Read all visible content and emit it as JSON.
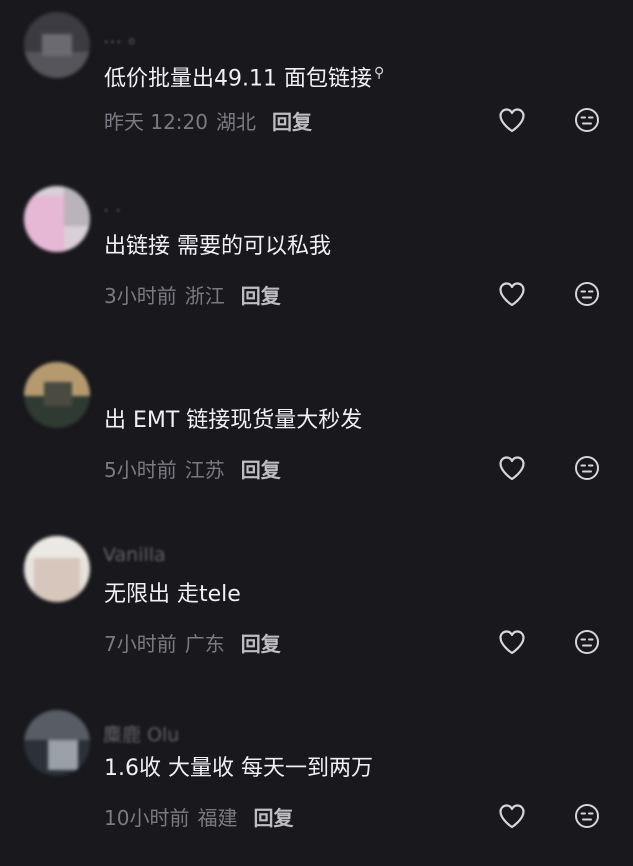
{
  "comments": [
    {
      "username": "… 。",
      "text": "低价批量出49.11 面包链接",
      "time": "昨天 12:20",
      "location": "湖北",
      "reply": "回复",
      "has_search_icon": true
    },
    {
      "username": "· ·",
      "text": "出链接 需要的可以私我",
      "time": "3小时前",
      "location": "浙江",
      "reply": "回复"
    },
    {
      "username": "",
      "text": "出 EMT  链接现货量大秒发",
      "time": "5小时前",
      "location": "江苏",
      "reply": "回复"
    },
    {
      "username": "Vanilla",
      "text": "无限出 走tele",
      "time": "7小时前",
      "location": "广东",
      "reply": "回复"
    },
    {
      "username": "麋鹿 Olu",
      "text": "1.6收 大量收 每天一到两万",
      "time": "10小时前",
      "location": "福建",
      "reply": "回复"
    }
  ],
  "colors": {
    "background": "#18181d",
    "text": "#f1f1f3",
    "meta": "#7a7a82",
    "reply": "#bdbdc3",
    "icon": "#d6d6da"
  },
  "icons": {
    "like": "heart-outline-icon",
    "dislike": "neutral-face-icon",
    "search": "search-icon"
  }
}
